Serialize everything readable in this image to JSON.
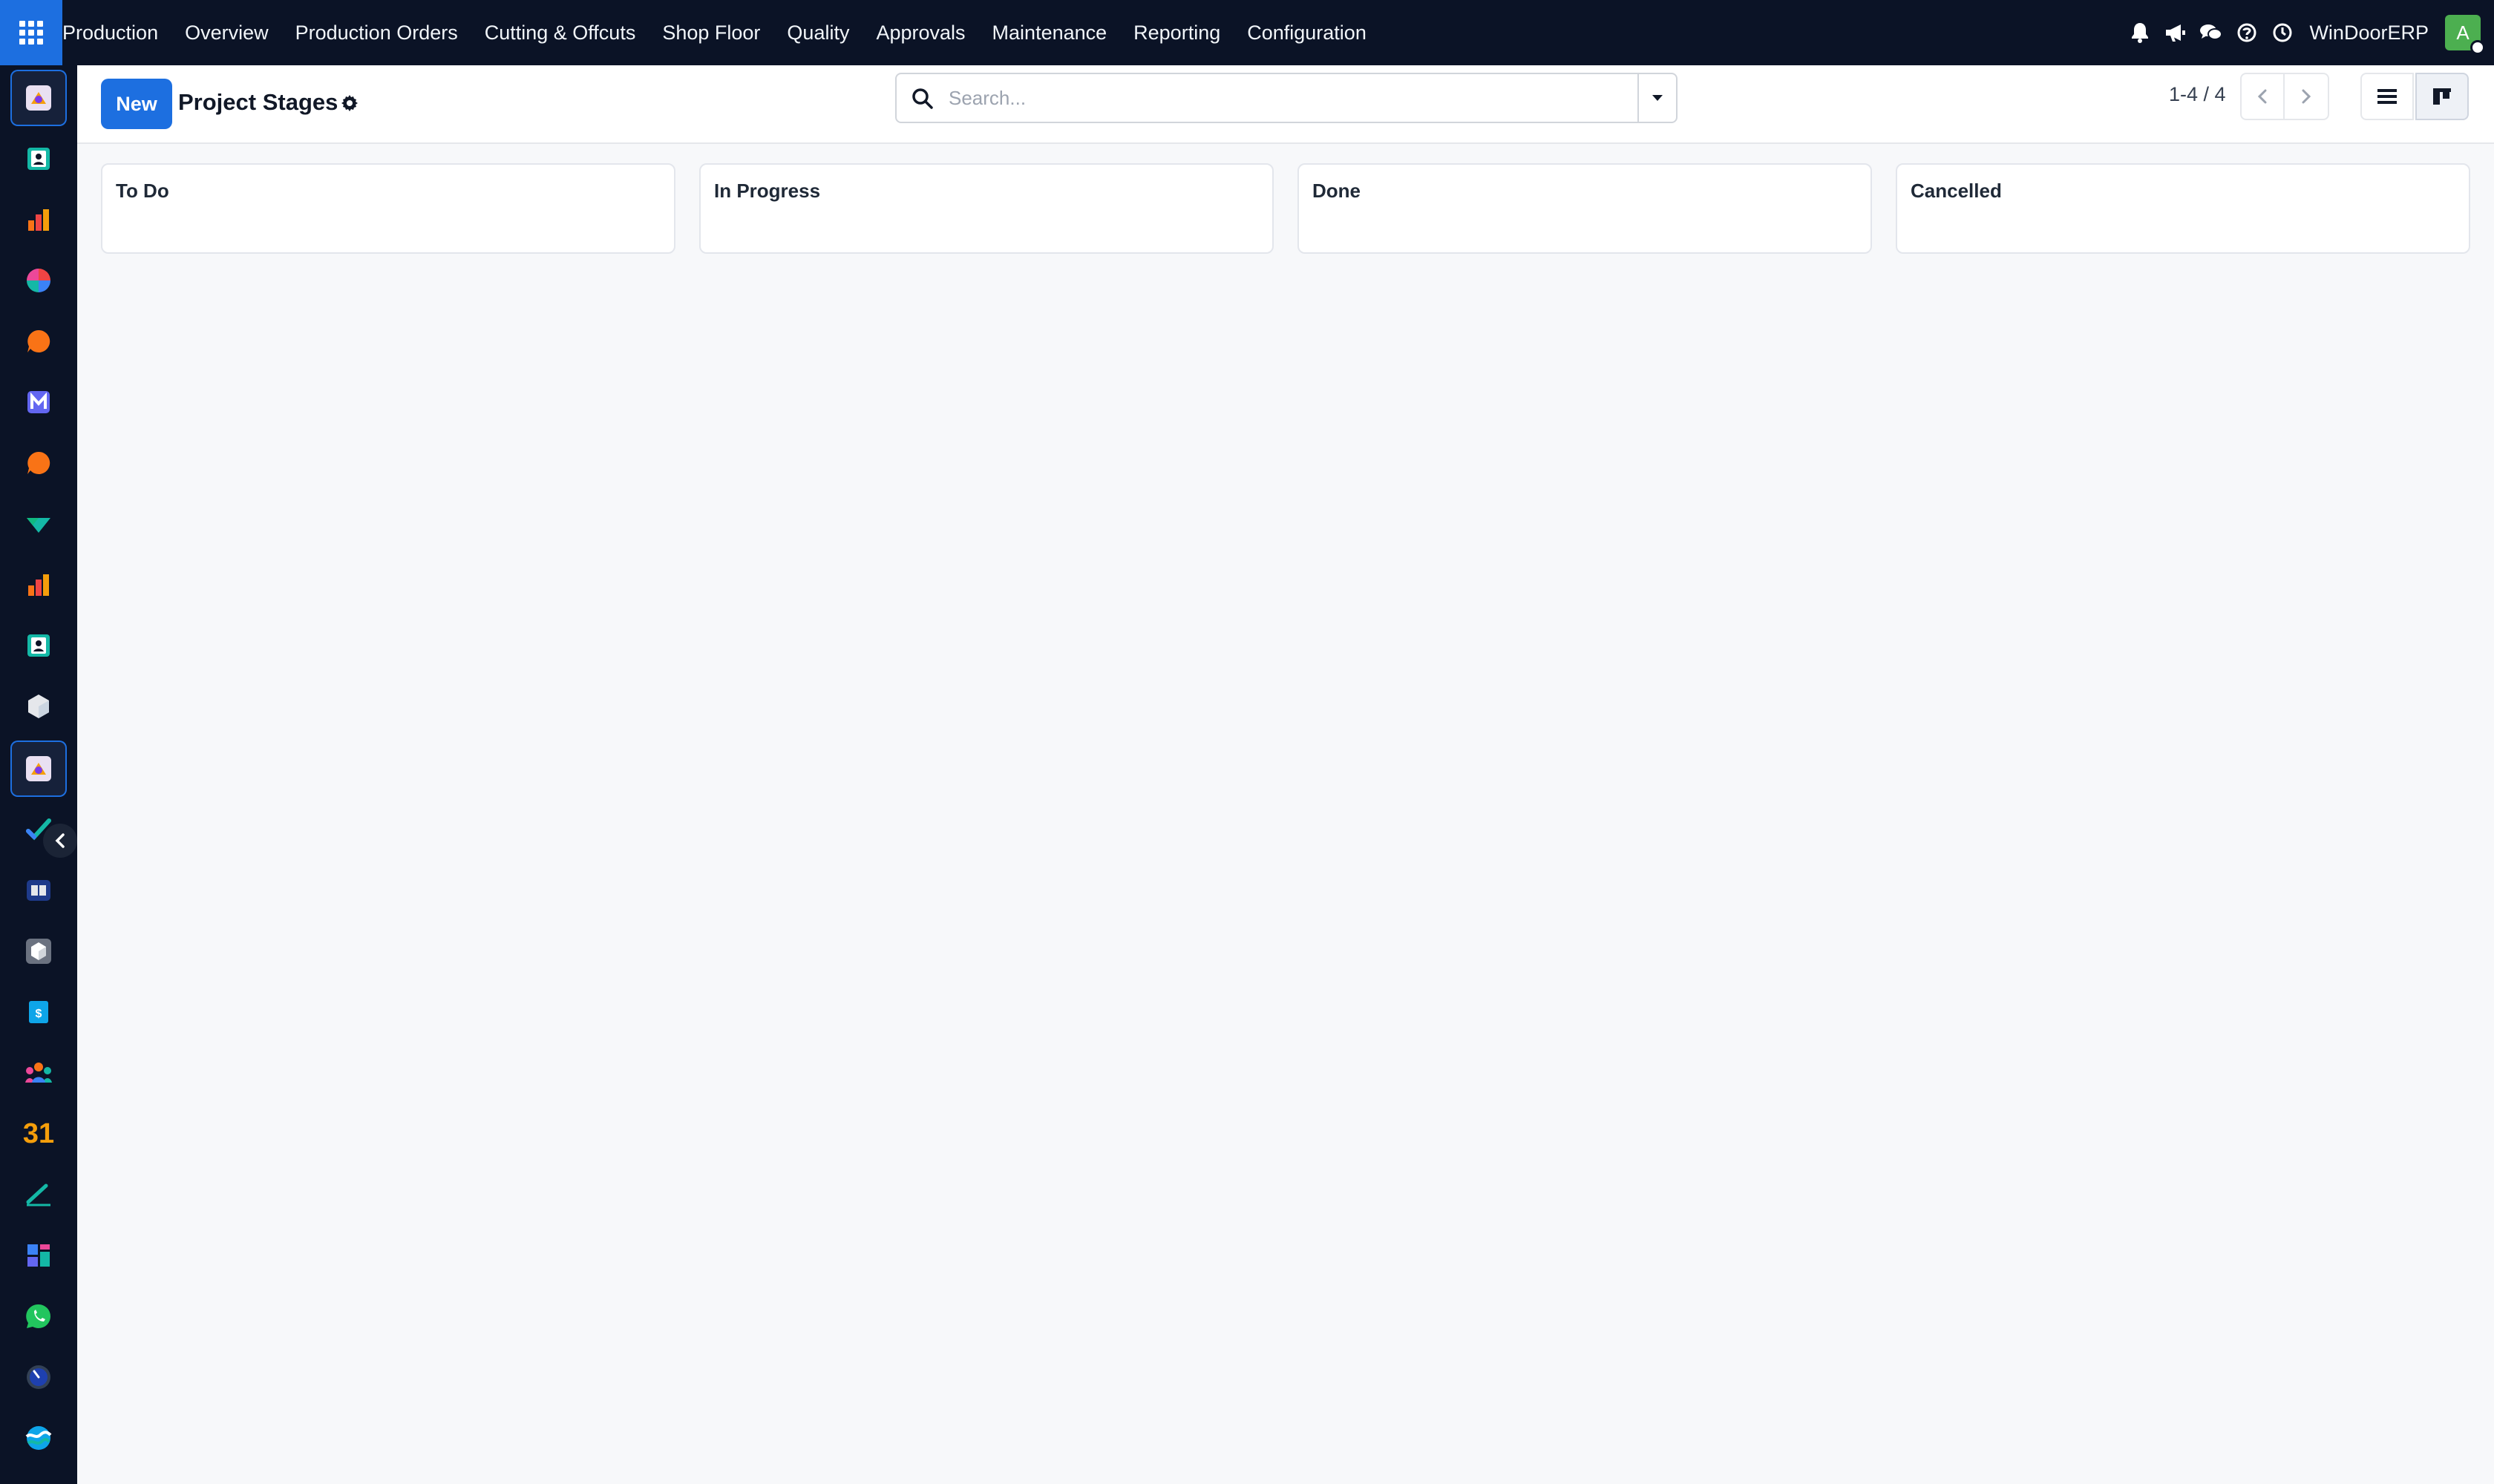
{
  "navbar": {
    "app_name": "Production",
    "menu": [
      "Overview",
      "Production Orders",
      "Cutting & Offcuts",
      "Shop Floor",
      "Quality",
      "Approvals",
      "Maintenance",
      "Reporting",
      "Configuration"
    ],
    "company": "WinDoorERP",
    "avatar_initial": "A",
    "tray_icons": [
      "bell-icon",
      "megaphone-icon",
      "chat-icon",
      "help-icon",
      "clock-icon"
    ]
  },
  "sidebar": {
    "apps": [
      "production-app-icon",
      "contacts-app-icon",
      "dashboards-app-icon",
      "reporting-app-icon",
      "discuss-app-icon",
      "email-marketing-app-icon",
      "discuss-app-icon",
      "project-app-icon",
      "spreadsheet-app-icon",
      "employees-app-icon",
      "inventory-app-icon",
      "production-app-icon",
      "todo-app-icon",
      "knowledge-app-icon",
      "barcode-app-icon",
      "accounting-app-icon",
      "crm-team-app-icon",
      "calendar-app-icon",
      "sign-app-icon",
      "dashboard-app-icon",
      "whatsapp-app-icon",
      "appointments-app-icon",
      "website-app-icon"
    ],
    "calendar_label": "31",
    "active_index": 11
  },
  "control_panel": {
    "new_label": "New",
    "title": "Project Stages",
    "search_placeholder": "Search...",
    "pager": "1-4 / 4"
  },
  "kanban": {
    "columns": [
      "To Do",
      "In Progress",
      "Done",
      "Cancelled"
    ]
  },
  "colors": {
    "navbar_bg": "#0b1326",
    "primary": "#1d6fe0",
    "page_bg": "#f7f8fa",
    "avatar_bg": "#4caf50"
  }
}
